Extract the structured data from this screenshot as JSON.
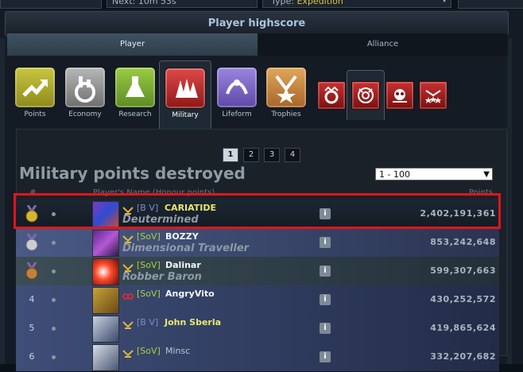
{
  "topbar": {
    "next_label": "Next: 10m 53s",
    "type_label": "Type:",
    "type_value": "Expedition"
  },
  "header": {
    "title": "Player highscore"
  },
  "tabs": [
    {
      "label": "Player",
      "active": true
    },
    {
      "label": "Alliance",
      "active": false
    }
  ],
  "categories": [
    {
      "label": "Points",
      "icon": "points-icon"
    },
    {
      "label": "Economy",
      "icon": "economy-icon"
    },
    {
      "label": "Research",
      "icon": "research-icon"
    },
    {
      "label": "Military",
      "icon": "military-icon",
      "active": true
    },
    {
      "label": "Lifeform",
      "icon": "lifeform-icon"
    },
    {
      "label": "Trophies",
      "icon": "trophies-icon"
    }
  ],
  "subcategories": [
    {
      "icon": "military-built-icon"
    },
    {
      "icon": "military-destroyed-icon",
      "active": true
    },
    {
      "icon": "military-lost-icon"
    },
    {
      "icon": "honour-icon"
    }
  ],
  "pagination": [
    "1",
    "2",
    "3",
    "4"
  ],
  "current_page": "1",
  "title": "Military points destroyed",
  "range_select": {
    "value": "1 - 100"
  },
  "columns": {
    "rank": "#",
    "name": "Player's Name (Honour points)",
    "points": "Points"
  },
  "rows": [
    {
      "rank": "",
      "tag": "[B V]",
      "name": "CARIATIDE",
      "subtitle": "Deutermined",
      "points": "2,402,191,361"
    },
    {
      "rank": "",
      "tag": "[SoV]",
      "name": "BOZZY",
      "subtitle": "Dimensional Traveller",
      "points": "853,242,648"
    },
    {
      "rank": "",
      "tag": "[SoV]",
      "name": "Dalinar",
      "subtitle": "Robber Baron",
      "points": "599,307,663"
    },
    {
      "rank": "4",
      "tag": "[SoV]",
      "name": "AngryVito",
      "subtitle": "",
      "points": "430,252,572"
    },
    {
      "rank": "5",
      "tag": "[B V]",
      "name": "John Sberla",
      "subtitle": "",
      "points": "419,865,624"
    },
    {
      "rank": "6",
      "tag": "[SoV]",
      "name": "Minsc",
      "subtitle": "",
      "points": "332,207,682"
    }
  ],
  "colors": {
    "highlight": "#e0151b",
    "own_name": "#e9e86a",
    "alliance_sov": "#a9d23e",
    "alliance_bv": "#7c8ec5"
  }
}
